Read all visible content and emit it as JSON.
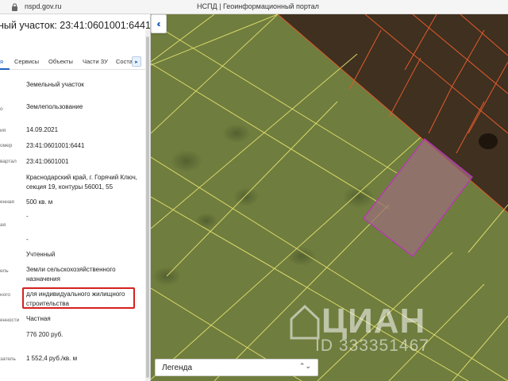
{
  "browser": {
    "url": "nspd.gov.ru",
    "page_title": "НСПД | Геоинформационный портал"
  },
  "panel": {
    "title": "ный участок: 23:41:0601001:6441",
    "tabs": [
      "я",
      "Сервисы",
      "Объекты",
      "Части ЗУ",
      "Соста"
    ],
    "rows": [
      {
        "label": "",
        "value": "Земельный участок"
      },
      {
        "label": "о",
        "value": "Землепользование"
      },
      {
        "label": "ия",
        "value": "14.09.2021"
      },
      {
        "label": "омер",
        "value": "23:41:0601001:6441"
      },
      {
        "label": "вартал",
        "value": "23:41:0601001"
      },
      {
        "label": "",
        "value": "Краснодарский край, г. Горячий Ключ, секция 19, контуры 56001, 55"
      },
      {
        "label": "енная",
        "value": "500 кв. м"
      },
      {
        "label": "",
        "value": "-"
      },
      {
        "label": "ая",
        "value": ""
      },
      {
        "label": "",
        "value": "-"
      },
      {
        "label": "",
        "value": "Учтенный"
      },
      {
        "label": "ель",
        "value": "Земли сельскохозяйственного назначения"
      },
      {
        "label": "ного",
        "value": "для индивидуального жилищного строительства"
      },
      {
        "label": "енности",
        "value": "Частная"
      },
      {
        "label": "",
        "value": "776 200 руб."
      },
      {
        "label": "затель",
        "value": "1 552,4 руб./кв. м"
      }
    ]
  },
  "map": {
    "legend_label": "Легенда",
    "legend_arrows": "⌃⌄",
    "watermark_brand": "ЦИАН",
    "watermark_id": "ID 333351467"
  },
  "colors": {
    "accent": "#1f5fbf",
    "highlight": "#d62020",
    "parcel_border": "#c030c0"
  }
}
